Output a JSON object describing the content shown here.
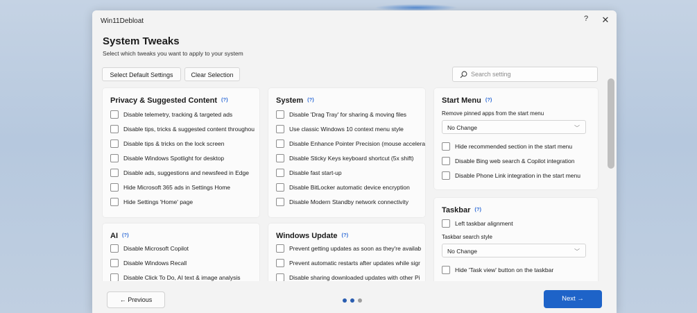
{
  "window": {
    "title": "Win11Debloat",
    "help_label": "?",
    "close_label": "✕"
  },
  "page": {
    "title": "System Tweaks",
    "subtitle": "Select which tweaks you want to apply to your system"
  },
  "toolbar": {
    "select_default_label": "Select Default Settings",
    "clear_selection_label": "Clear Selection"
  },
  "search": {
    "placeholder": "Search setting",
    "value": ""
  },
  "info_badge": "(?)",
  "cards": {
    "privacy": {
      "title": "Privacy & Suggested Content",
      "items": [
        "Disable telemetry, tracking & targeted ads",
        "Disable tips, tricks & suggested content throughou",
        "Disable tips & tricks on the lock screen",
        "Disable Windows Spotlight for desktop",
        "Disable ads, suggestions and newsfeed in Edge",
        "Hide Microsoft 365 ads in Settings Home",
        "Hide Settings 'Home' page"
      ]
    },
    "system": {
      "title": "System",
      "items": [
        "Disable 'Drag Tray' for sharing & moving files",
        "Use classic Windows 10 context menu style",
        "Disable Enhance Pointer Precision (mouse accelera",
        "Disable Sticky Keys keyboard shortcut (5x shift)",
        "Disable fast start-up",
        "Disable BitLocker automatic device encryption",
        "Disable Modern Standby network connectivity"
      ]
    },
    "start_menu": {
      "title": "Start Menu",
      "field_label": "Remove pinned apps from the start menu",
      "select_value": "No Change",
      "items": [
        "Hide recommended section in the start menu",
        "Disable Bing web search & Copilot integration",
        "Disable Phone Link integration in the start menu"
      ]
    },
    "ai": {
      "title": "AI",
      "items": [
        "Disable Microsoft Copilot",
        "Disable Windows Recall",
        "Disable Click To Do, AI text & image analysis"
      ]
    },
    "windows_update": {
      "title": "Windows Update",
      "items": [
        "Prevent getting updates as soon as they're availab",
        "Prevent automatic restarts after updates while sigr",
        "Disable sharing downloaded updates with other Pi"
      ]
    },
    "taskbar": {
      "title": "Taskbar",
      "item_top": "Left taskbar alignment",
      "field_label": "Taskbar search style",
      "select_value": "No Change",
      "item_bottom": "Hide 'Task view' button on the taskbar"
    }
  },
  "footer": {
    "previous_label": "← Previous",
    "next_label": "Next →",
    "page_count": 3,
    "current_page": 2
  },
  "colors": {
    "accent": "#1e63c8",
    "info": "#2e6bd6",
    "dot_active": "#2a5db0",
    "dot_inactive": "#9e9e9e"
  }
}
